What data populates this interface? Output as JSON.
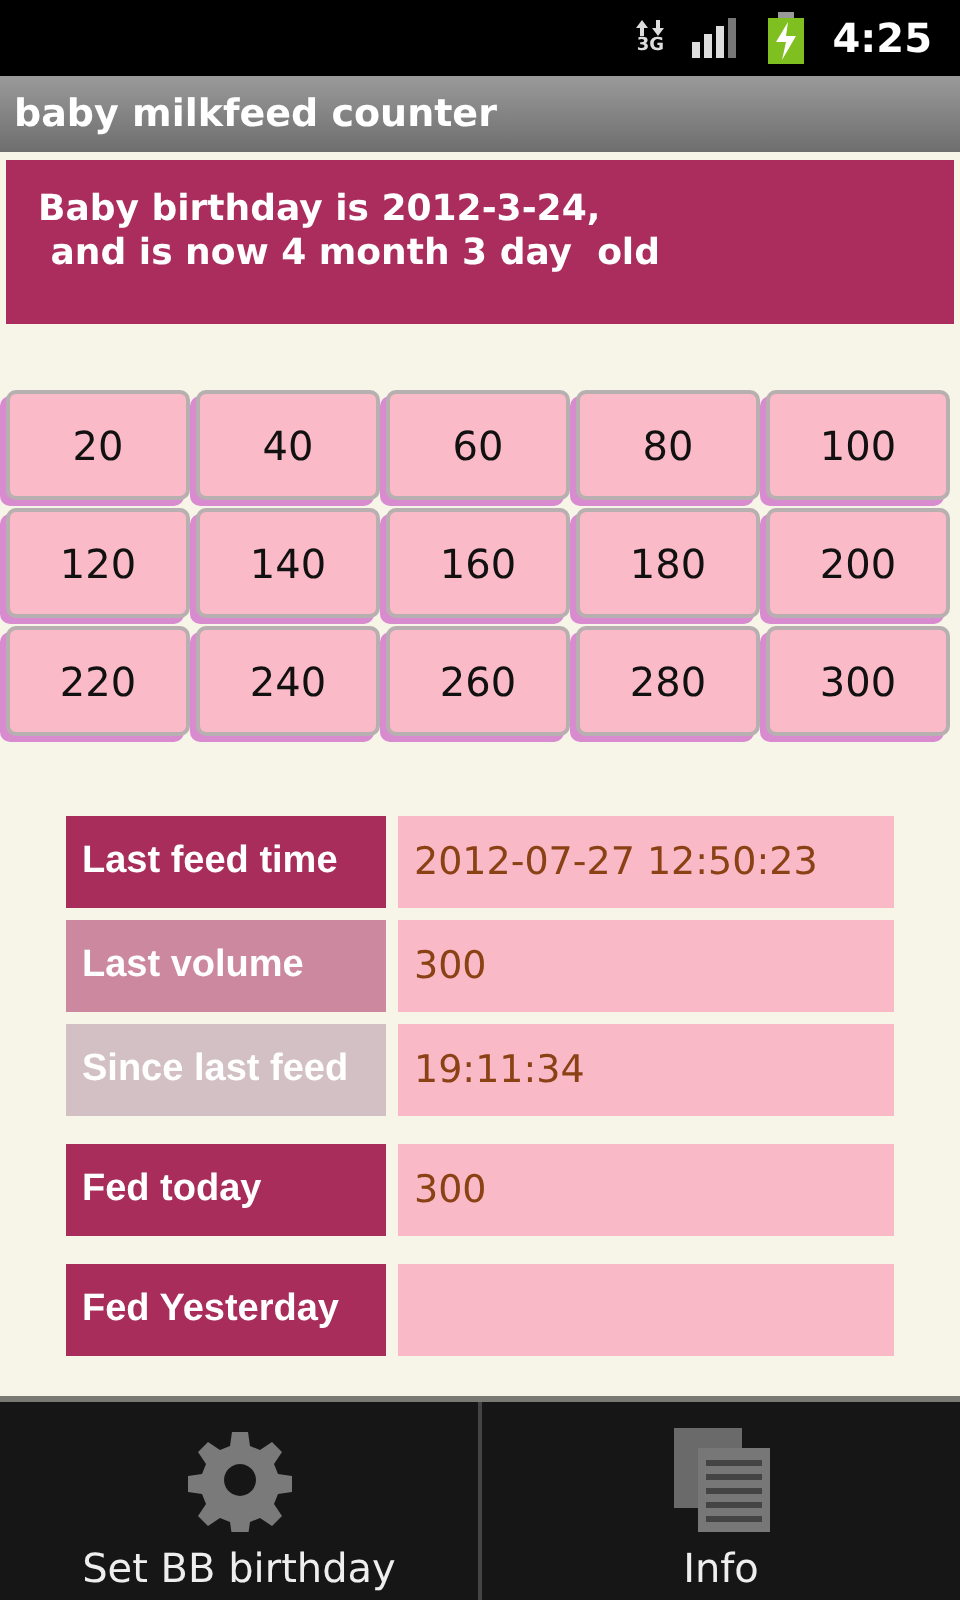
{
  "status_bar": {
    "network": "3G",
    "time": "4:25"
  },
  "window": {
    "title": "baby milkfeed counter"
  },
  "banner": {
    "text": "Baby birthday is 2012-3-24,\n and is now 4 month 3 day  old"
  },
  "volume_buttons": [
    "20",
    "40",
    "60",
    "80",
    "100",
    "120",
    "140",
    "160",
    "180",
    "200",
    "220",
    "240",
    "260",
    "280",
    "300"
  ],
  "stats": [
    {
      "label": "Last feed time",
      "value": "2012-07-27 12:50:23",
      "color": "#a82d5b"
    },
    {
      "label": "Last volume",
      "value": "300",
      "color": "#cc889f"
    },
    {
      "label": "Since last feed",
      "value": "19:11:34",
      "color": "#d3c0c4"
    },
    {
      "label": "Fed today",
      "value": "300",
      "color": "#a82d5b"
    },
    {
      "label": "Fed Yesterday",
      "color": "#a82d5b"
    }
  ],
  "menu": [
    {
      "label": "Set BB birthday",
      "kind": "gear"
    },
    {
      "label": "Info",
      "kind": "documents"
    }
  ]
}
